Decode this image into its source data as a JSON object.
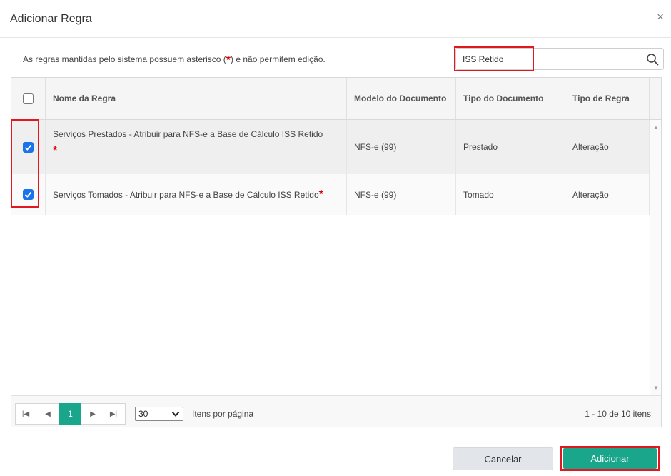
{
  "dialog": {
    "title": "Adicionar Regra",
    "close_icon": "×"
  },
  "info": {
    "prefix": "As regras mantidas pelo sistema possuem asterisco (",
    "star": "*",
    "suffix": ") e não permitem edição."
  },
  "search": {
    "value": "ISS Retido",
    "icon": "search-icon"
  },
  "grid": {
    "columns": [
      "Nome da Regra",
      "Modelo do Documento",
      "Tipo do Documento",
      "Tipo de Regra"
    ],
    "rows": [
      {
        "checked": true,
        "name": "Serviços Prestados - Atribuir para NFS-e a Base de Cálculo ISS Retido",
        "star": "*",
        "modelo": "NFS-e (99)",
        "tipo_documento": "Prestado",
        "tipo_regra": "Alteração"
      },
      {
        "checked": true,
        "name": "Serviços Tomados - Atribuir para NFS-e a Base de Cálculo ISS Retido",
        "star": "*",
        "modelo": "NFS-e (99)",
        "tipo_documento": "Tomado",
        "tipo_regra": "Alteração"
      }
    ]
  },
  "pager": {
    "current_page": "1",
    "page_size": "30",
    "page_size_label": "Itens por página",
    "info": "1 - 10 de 10 itens"
  },
  "footer": {
    "cancel": "Cancelar",
    "add": "Adicionar"
  },
  "colors": {
    "accent": "#1aa68a",
    "highlight": "#e3171f",
    "checkbox": "#1a73e8"
  }
}
